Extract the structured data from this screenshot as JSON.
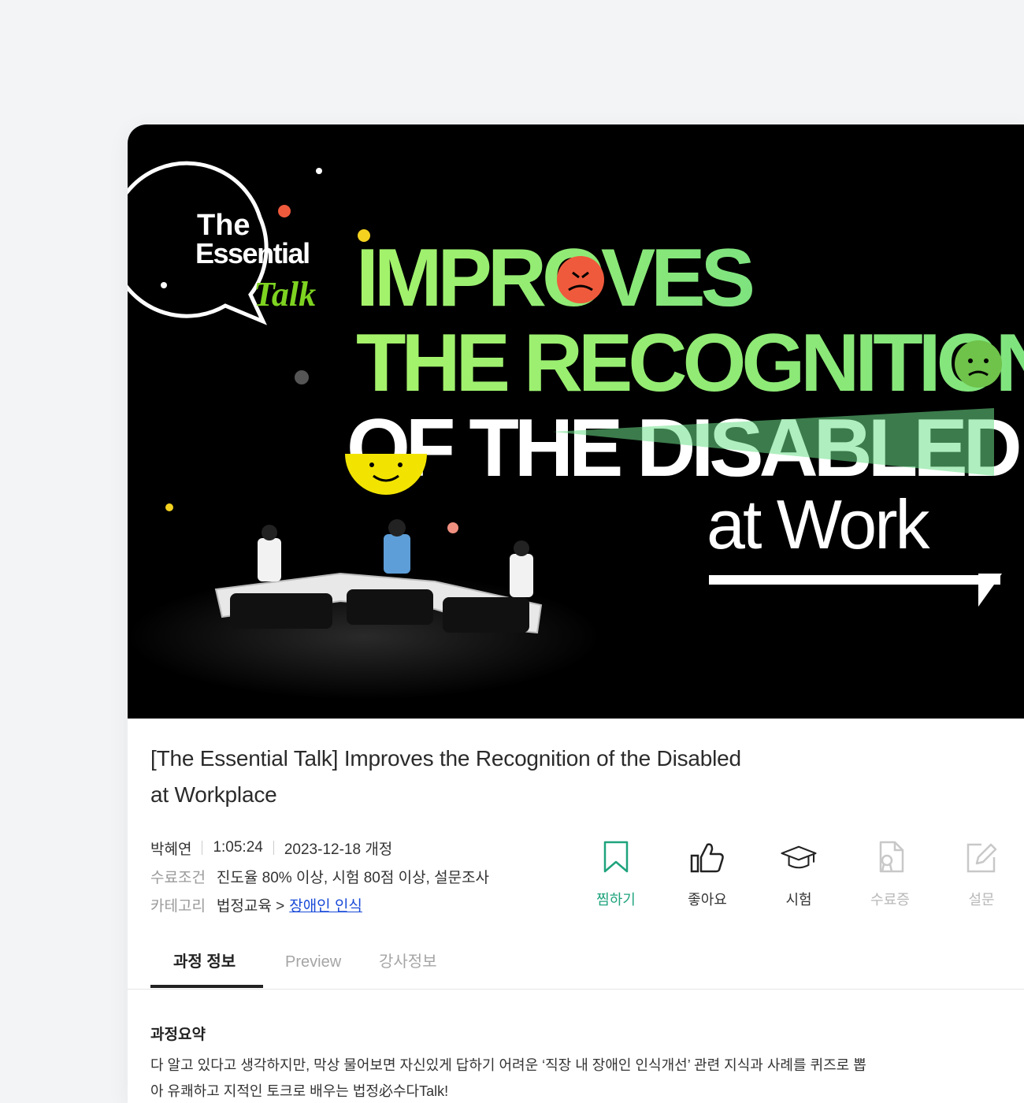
{
  "hero": {
    "logo": {
      "line1": "The",
      "line2": "Essential",
      "line3": "Talk"
    },
    "headline": {
      "line1": "IMPROVES",
      "line2": "THE RECOGNITION",
      "line3": "OF THE DISABLED",
      "line4": "at Work"
    },
    "colors": {
      "green": "#a3f06b",
      "white": "#ffffff",
      "yellow": "#f2e400",
      "red": "#f05a3c"
    }
  },
  "course": {
    "title": "[The Essential Talk] Improves the Recognition of the Disabled at Workplace",
    "instructor": "박혜연",
    "duration": "1:05:24",
    "date": "2023-12-18 개정",
    "completion_label": "수료조건",
    "completion_value": "진도율 80% 이상, 시험 80점 이상, 설문조사",
    "category_label": "카테고리",
    "category_parent": "법정교육 >",
    "category_link": "장애인 인식"
  },
  "actions": [
    {
      "label": "찜하기",
      "icon": "bookmark-icon"
    },
    {
      "label": "좋아요",
      "icon": "thumbs-up-icon"
    },
    {
      "label": "시험",
      "icon": "graduation-cap-icon"
    },
    {
      "label": "수료증",
      "icon": "certificate-icon"
    },
    {
      "label": "설문",
      "icon": "survey-edit-icon"
    }
  ],
  "tabs": [
    {
      "label": "과정 정보",
      "active": true
    },
    {
      "label": "Preview",
      "active": false
    },
    {
      "label": "강사정보",
      "active": false
    }
  ],
  "summary": {
    "title": "과정요약",
    "text": "다 알고 있다고 생각하지만, 막상 물어보면 자신있게 답하기 어려운 ‘직장 내 장애인 인식개선’ 관련 지식과 사례를 퀴즈로 뽑아 유쾌하고 지적인 토크로 배우는 법정必수다Talk!"
  }
}
